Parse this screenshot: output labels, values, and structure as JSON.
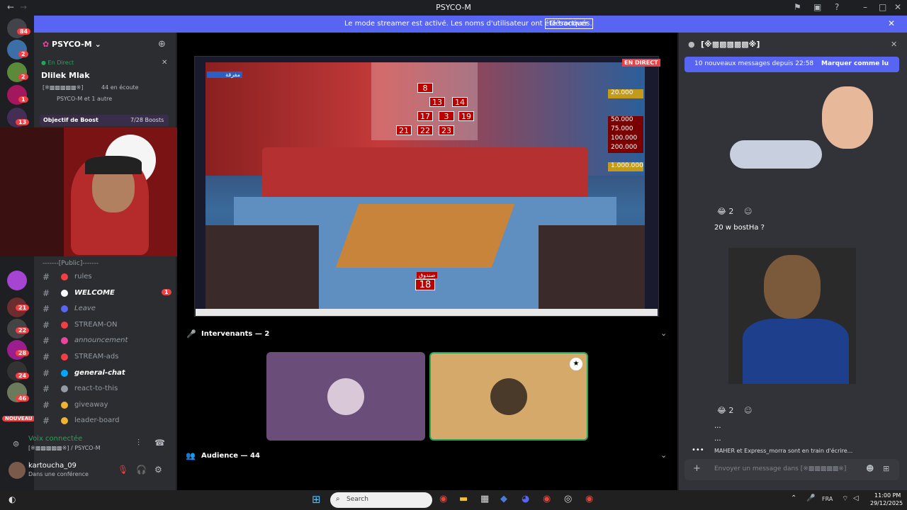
{
  "window": {
    "title": "PSYCO-M"
  },
  "banner": {
    "message": "Le mode streamer est activé. Les noms d'utilisateur ont été tronqués.",
    "button": "Désactiver"
  },
  "server_badges": [
    "84",
    "2",
    "1",
    "13",
    "21",
    "22",
    "28",
    "24",
    "46",
    "NOUVEAU"
  ],
  "guild": {
    "name": "PSYCO-M",
    "live_label": "En Direct",
    "live_title": "Dlilek Mlak",
    "live_channel": "[※▩▩▩▩▩※]",
    "listening": "44 en écoute",
    "with": "PSYCO-M et 1 autre",
    "boost_label": "Objectif de Boost",
    "boost_count": "7/28 Boosts"
  },
  "channels": [
    {
      "label": "rules",
      "dot": "#f23f43",
      "bold": false,
      "italic": false
    },
    {
      "label": "WELCOME",
      "dot": "#ffffff",
      "bold": true,
      "italic": true,
      "badge": "1"
    },
    {
      "label": "Leave",
      "dot": "#5865f2",
      "bold": false,
      "italic": true
    },
    {
      "label": "STREAM-ON",
      "dot": "#f23f43",
      "bold": false,
      "italic": false
    },
    {
      "label": "announcement",
      "dot": "#eb459e",
      "bold": false,
      "italic": true
    },
    {
      "label": "STREAM-ads",
      "dot": "#f23f43",
      "bold": false,
      "italic": false
    },
    {
      "label": "general-chat",
      "dot": "#00a8fc",
      "bold": true,
      "italic": true
    },
    {
      "label": "react-to-this",
      "dot": "#949ba4",
      "bold": false,
      "italic": false
    },
    {
      "label": "giveaway",
      "dot": "#f0b232",
      "bold": false,
      "italic": false
    },
    {
      "label": "leader-board",
      "dot": "#f0b232",
      "bold": false,
      "italic": false
    }
  ],
  "category": "-------[Public]-------",
  "voice": {
    "status": "Voix connectée",
    "location": "[※▩▩▩▩▩※] / PSYCO-M"
  },
  "user": {
    "name": "kartoucha_09",
    "status": "Dans une conférence"
  },
  "stream": {
    "live_tag": "EN DIRECT",
    "top_left": "مفرقة",
    "bottom_label": "صندوق",
    "bottom_number": "18",
    "numbers": [
      "8",
      "13",
      "14",
      "17",
      "3",
      "19",
      "21",
      "22",
      "23"
    ],
    "prizes": [
      "20.000",
      "50.000",
      "75.000",
      "100.000",
      "200.000",
      "1.000.000"
    ]
  },
  "speakers": {
    "label": "Intervenants — 2"
  },
  "audience": {
    "label": "Audience — 44"
  },
  "chat": {
    "channel": "[※▩▩▩▩▩※]",
    "new_messages": "10 nouveaux messages depuis 22:58",
    "mark_read": "Marquer comme lu",
    "reaction_count": "2",
    "message": "20 w bostHa ?",
    "reaction_count_2": "2",
    "ellipsis_1": "...",
    "ellipsis_2": "...",
    "typing": "MAHER et Express_morra sont en train d'écrire...",
    "placeholder": "Envoyer un message dans [※▩▩▩▩▩※]"
  },
  "taskbar": {
    "search": "Search",
    "lang": "FRA",
    "time": "11:00 PM",
    "date": "29/12/2025"
  },
  "colors": {
    "accent": "#5865f2",
    "live": "#ed4245",
    "tile1": "#6b4d7a",
    "tile2": "#d4a96a"
  }
}
